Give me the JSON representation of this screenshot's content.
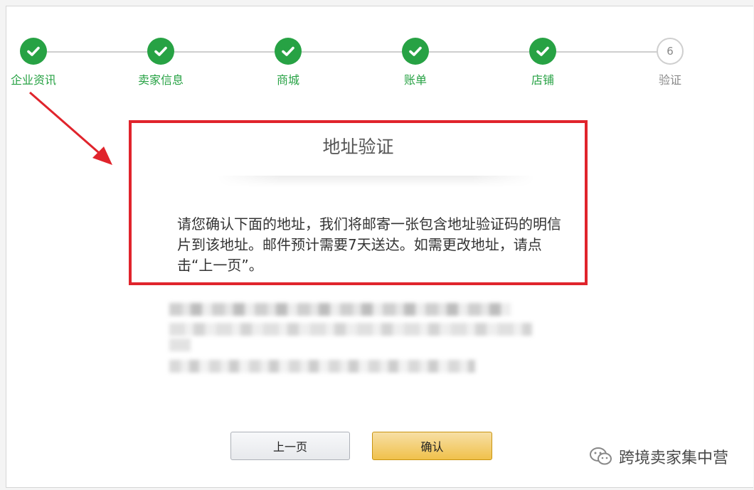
{
  "stepper": {
    "steps": [
      {
        "label": "企业资讯",
        "status": "done"
      },
      {
        "label": "卖家信息",
        "status": "done"
      },
      {
        "label": "商城",
        "status": "done"
      },
      {
        "label": "账单",
        "status": "done"
      },
      {
        "label": "店铺",
        "status": "done"
      },
      {
        "label": "验证",
        "status": "current",
        "number": "6"
      }
    ]
  },
  "panel": {
    "title": "地址验证",
    "message": "请您确认下面的地址，我们将邮寄一张包含地址验证码的明信片到该地址。邮件预计需要7天送达。如需更改地址，请点击“上一页”。"
  },
  "buttons": {
    "back_label": "上一页",
    "confirm_label": "确认"
  },
  "watermark": {
    "text": "跨境卖家集中营"
  },
  "colors": {
    "done_green": "#27a244",
    "annotation_red": "#e0242c",
    "confirm_yellow": "#f0c14b"
  }
}
